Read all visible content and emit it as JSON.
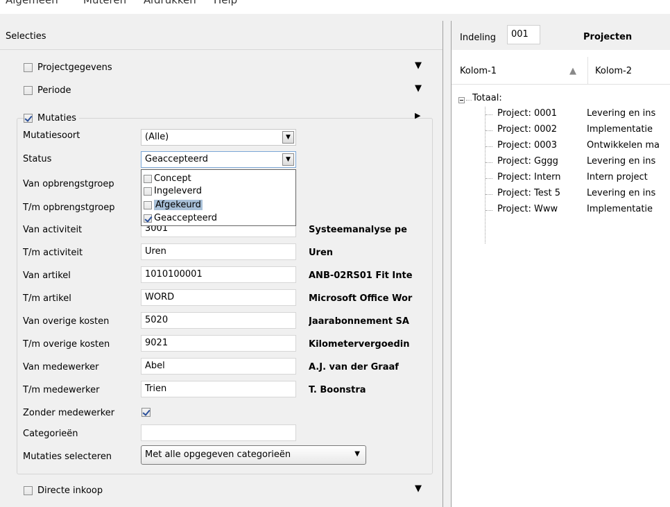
{
  "menu": [
    "Algemeen",
    "Muteren",
    "Afdrukken",
    "Help"
  ],
  "left": {
    "title": "Selecties",
    "groups": [
      {
        "label": "Projectgegevens",
        "checked": false
      },
      {
        "label": "Periode",
        "checked": false
      },
      {
        "label": "Mutaties",
        "checked": true
      },
      {
        "label": "Directe inkoop",
        "checked": false
      }
    ],
    "fields": {
      "mutatiesoort": {
        "label": "Mutatiesoort",
        "value": "(Alle)"
      },
      "status": {
        "label": "Status",
        "value": "Geaccepteerd"
      },
      "van_opbrengstgroep": {
        "label": "Van opbrengstgroep"
      },
      "tm_opbrengstgroep": {
        "label": "T/m opbrengstgroep"
      },
      "van_activiteit": {
        "label": "Van activiteit",
        "value": "3001",
        "desc": "Systeemanalyse pe"
      },
      "tm_activiteit": {
        "label": "T/m activiteit",
        "value": "Uren",
        "desc": "Uren"
      },
      "van_artikel": {
        "label": "Van artikel",
        "value": "1010100001",
        "desc": "ANB-02RS01 Fit Inte"
      },
      "tm_artikel": {
        "label": "T/m artikel",
        "value": "WORD",
        "desc": "Microsoft Office Wor"
      },
      "van_overige": {
        "label": "Van overige kosten",
        "value": "5020",
        "desc": "Jaarabonnement SA"
      },
      "tm_overige": {
        "label": "T/m overige kosten",
        "value": "9021",
        "desc": "Kilometervergoedin"
      },
      "van_medewerker": {
        "label": "Van medewerker",
        "value": "Abel",
        "desc": "A.J. van der Graaf"
      },
      "tm_medewerker": {
        "label": "T/m medewerker",
        "value": "Trien",
        "desc": "T. Boonstra"
      },
      "zonder_medewerker": {
        "label": "Zonder medewerker",
        "checked": true
      },
      "categorieen": {
        "label": "Categorieën",
        "value": ""
      },
      "mutaties_selecteren": {
        "label": "Mutaties selecteren",
        "value": "Met alle opgegeven categorieën"
      }
    },
    "status_options": [
      {
        "label": "Concept",
        "checked": false
      },
      {
        "label": "Ingeleverd",
        "checked": false
      },
      {
        "label": "Afgekeurd",
        "checked": false
      },
      {
        "label": "Geaccepteerd",
        "checked": true
      }
    ]
  },
  "right": {
    "indeling_label": "Indeling",
    "indeling_value": "001",
    "title": "Projecten",
    "col1": "Kolom-1",
    "col2": "Kolom-2",
    "root": "Totaal:",
    "rows": [
      {
        "c1": "Project: 0001",
        "c2": "Levering en ins"
      },
      {
        "c1": "Project: 0002",
        "c2": "Implementatie"
      },
      {
        "c1": "Project: 0003",
        "c2": "Ontwikkelen ma"
      },
      {
        "c1": "Project: Gggg",
        "c2": "Levering en ins"
      },
      {
        "c1": "Project: Intern",
        "c2": "Intern project"
      },
      {
        "c1": "Project: Test 5",
        "c2": "Levering en ins"
      },
      {
        "c1": "Project: Www",
        "c2": "Implementatie"
      }
    ]
  }
}
